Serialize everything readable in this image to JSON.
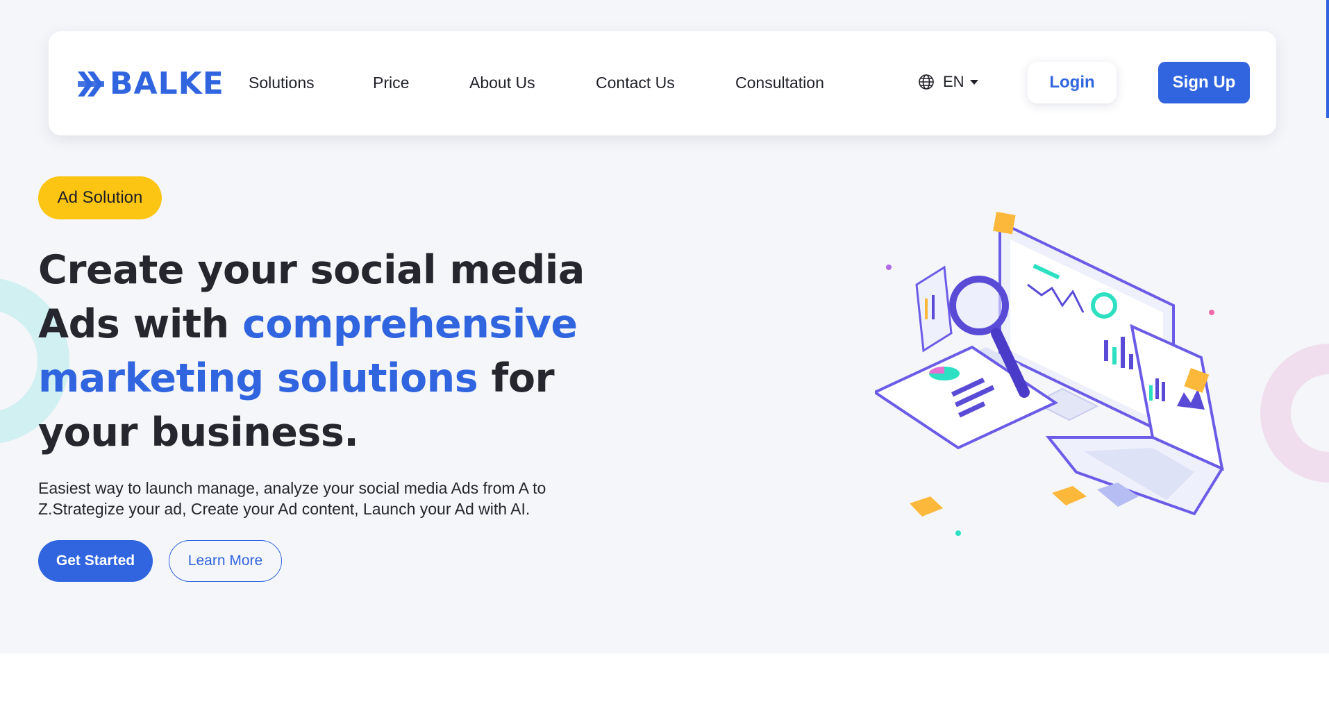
{
  "brand": {
    "name": "BALKE",
    "color": "#3065df"
  },
  "nav": {
    "links": [
      "Solutions",
      "Price",
      "About Us",
      "Contact Us",
      "Consultation"
    ],
    "language": "EN",
    "login_label": "Login",
    "signup_label": "Sign Up"
  },
  "hero": {
    "badge": "Ad Solution",
    "headline_part1": "Create your social media Ads with ",
    "headline_highlight": "comprehensive marketing solutions",
    "headline_part2": " for your business.",
    "subtext": "Easiest way to launch manage, analyze your social media Ads from A to Z.Strategize your ad, Create your Ad content, Launch your Ad with AI.",
    "primary_cta": "Get Started",
    "secondary_cta": "Learn More"
  },
  "colors": {
    "accent": "#3065df",
    "badge": "#fcc514",
    "text": "#26272e",
    "hero_bg": "#f5f6fa"
  },
  "icons": {
    "language": "globe-icon",
    "language_menu": "caret-down-icon",
    "logo_mark": "logo-mark-icon"
  }
}
